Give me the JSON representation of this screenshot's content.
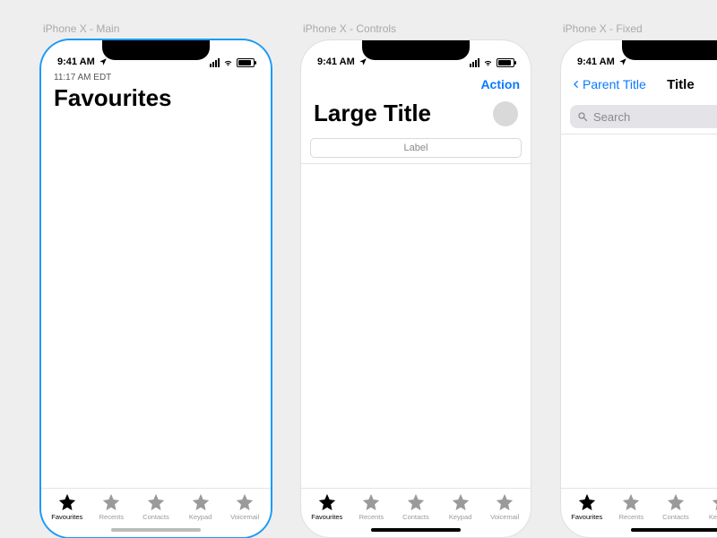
{
  "artboards": {
    "main": {
      "label": "iPhone X - Main"
    },
    "controls": {
      "label": "iPhone X - Controls"
    },
    "fixed": {
      "label": "iPhone X - Fixed"
    }
  },
  "status": {
    "time": "9:41 AM"
  },
  "main": {
    "eyebrow": "11:17 AM EDT",
    "title": "Favourites"
  },
  "controls": {
    "action": "Action",
    "title": "Large Title",
    "segment_label": "Label"
  },
  "fixed": {
    "back_label": "Parent Title",
    "title": "Title",
    "search_placeholder": "Search"
  },
  "tabs": [
    {
      "label": "Favourites",
      "active": true
    },
    {
      "label": "Recents",
      "active": false
    },
    {
      "label": "Contacts",
      "active": false
    },
    {
      "label": "Keypad",
      "active": false
    },
    {
      "label": "Voicemail",
      "active": false
    }
  ],
  "colors": {
    "tint": "#0a7aff"
  }
}
